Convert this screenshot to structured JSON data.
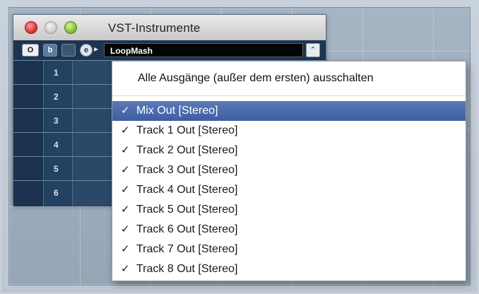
{
  "window": {
    "title": "VST-Instrumente",
    "instrument_name": "LoopMash",
    "toolbar": {
      "btn1": "O",
      "btn2": "b",
      "btn3": "",
      "btn4": "e",
      "arrow": "▸"
    },
    "slots": [
      {
        "number": "1"
      },
      {
        "number": "2"
      },
      {
        "number": "3"
      },
      {
        "number": "4"
      },
      {
        "number": "5"
      },
      {
        "number": "6"
      }
    ],
    "collapse_glyph": "⌃"
  },
  "menu": {
    "header": "Alle Ausgänge (außer dem ersten) ausschalten",
    "check_glyph": "✓",
    "items": [
      {
        "label": "Mix Out [Stereo]",
        "checked": true,
        "selected": true
      },
      {
        "label": "Track 1 Out [Stereo]",
        "checked": true,
        "selected": false
      },
      {
        "label": "Track 2 Out [Stereo]",
        "checked": true,
        "selected": false
      },
      {
        "label": "Track 3 Out [Stereo]",
        "checked": true,
        "selected": false
      },
      {
        "label": "Track 4 Out [Stereo]",
        "checked": true,
        "selected": false
      },
      {
        "label": "Track 5 Out [Stereo]",
        "checked": true,
        "selected": false
      },
      {
        "label": "Track 6 Out [Stereo]",
        "checked": true,
        "selected": false
      },
      {
        "label": "Track 7 Out [Stereo]",
        "checked": true,
        "selected": false
      },
      {
        "label": "Track 8 Out [Stereo]",
        "checked": true,
        "selected": false
      }
    ]
  },
  "colors": {
    "selection": "#4a6aab",
    "window_panel": "#2a4460",
    "toolbar": "#1e3550"
  }
}
